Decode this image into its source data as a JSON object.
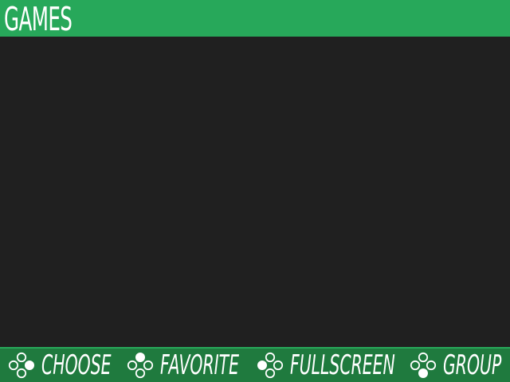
{
  "header": {
    "title": "GAMES"
  },
  "footer": {
    "actions": [
      {
        "label": "CHOOSE",
        "icon": "dpad-right-button-icon"
      },
      {
        "label": "FAVORITE",
        "icon": "dpad-top-button-icon"
      },
      {
        "label": "FULLSCREEN",
        "icon": "dpad-left-button-icon"
      },
      {
        "label": "GROUP",
        "icon": "dpad-bottom-button-icon"
      }
    ]
  },
  "colors": {
    "header_bg": "#27a85a",
    "footer_bg": "#1f7a3e",
    "content_bg": "#202020",
    "text": "#ffffff"
  }
}
